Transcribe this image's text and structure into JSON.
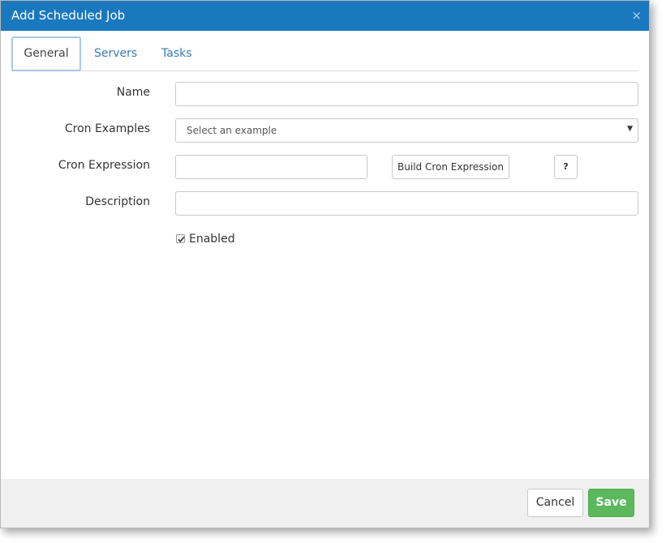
{
  "dialog": {
    "title": "Add Scheduled Job",
    "close_icon": "×"
  },
  "tabs": [
    {
      "label": "General",
      "active": true
    },
    {
      "label": "Servers",
      "active": false
    },
    {
      "label": "Tasks",
      "active": false
    }
  ],
  "form": {
    "name_label": "Name",
    "name_value": "",
    "cron_examples_label": "Cron Examples",
    "cron_examples_selected": "Select an example",
    "cron_expression_label": "Cron Expression",
    "cron_expression_value": "",
    "build_cron_button": "Build Cron Expression",
    "help_button": "?",
    "description_label": "Description",
    "description_value": "",
    "enabled_label": "Enabled",
    "enabled_checked": true
  },
  "footer": {
    "cancel_label": "Cancel",
    "save_label": "Save"
  },
  "colors": {
    "titlebar": "#1a78be",
    "link": "#337ab7",
    "save": "#5cb85c",
    "footer_bg": "#f0f0f0"
  }
}
